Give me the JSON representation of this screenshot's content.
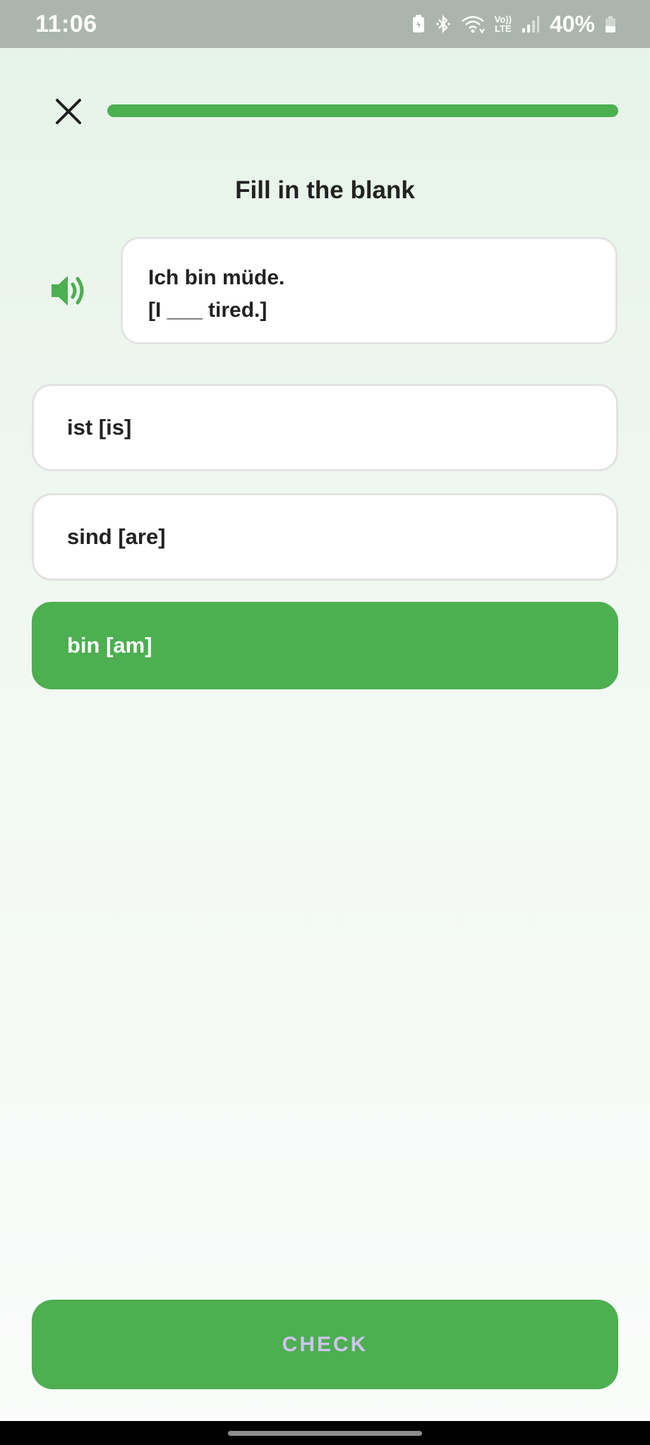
{
  "status_bar": {
    "time": "11:06",
    "volte_label": "Vo))",
    "lte_label": "LTE",
    "battery": "40%"
  },
  "progress": {
    "fraction": 1.0,
    "color": "#4caf50"
  },
  "prompt": {
    "title": "Fill in the blank"
  },
  "sentence": {
    "line1": "Ich bin müde.",
    "line2": "[I ___ tired.]"
  },
  "options": [
    {
      "label": "ist [is]",
      "selected": false
    },
    {
      "label": "sind [are]",
      "selected": false
    },
    {
      "label": "bin [am]",
      "selected": true
    }
  ],
  "check_button": {
    "label": "CHECK"
  },
  "colors": {
    "accent": "#4caf50",
    "check_text": "#cfc3ef",
    "status_bar": "#abb5ad"
  }
}
